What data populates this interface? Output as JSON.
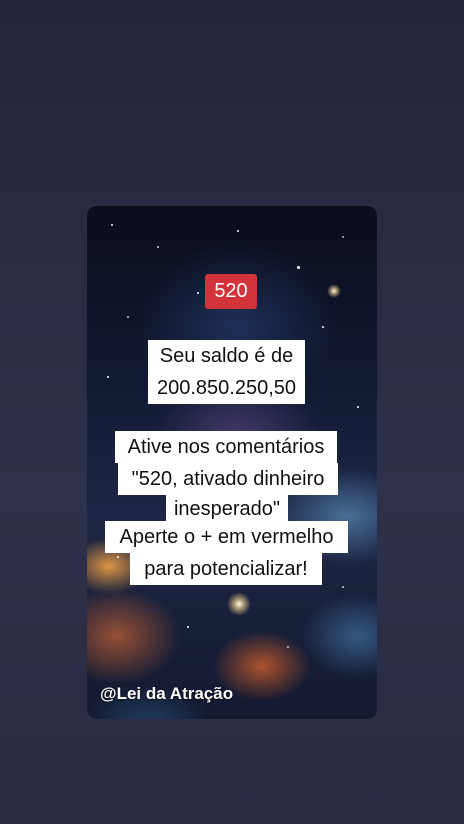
{
  "badge": {
    "text": "520",
    "color": "#d3333b"
  },
  "caption_lines": [
    "Seu saldo é de",
    "200.850.250,50",
    "Ative nos comentários",
    "\"520, ativado dinheiro",
    "inesperado\"",
    "Aperte o + em vermelho",
    "para potencializar!"
  ],
  "watermark": "@Lei da Atração"
}
